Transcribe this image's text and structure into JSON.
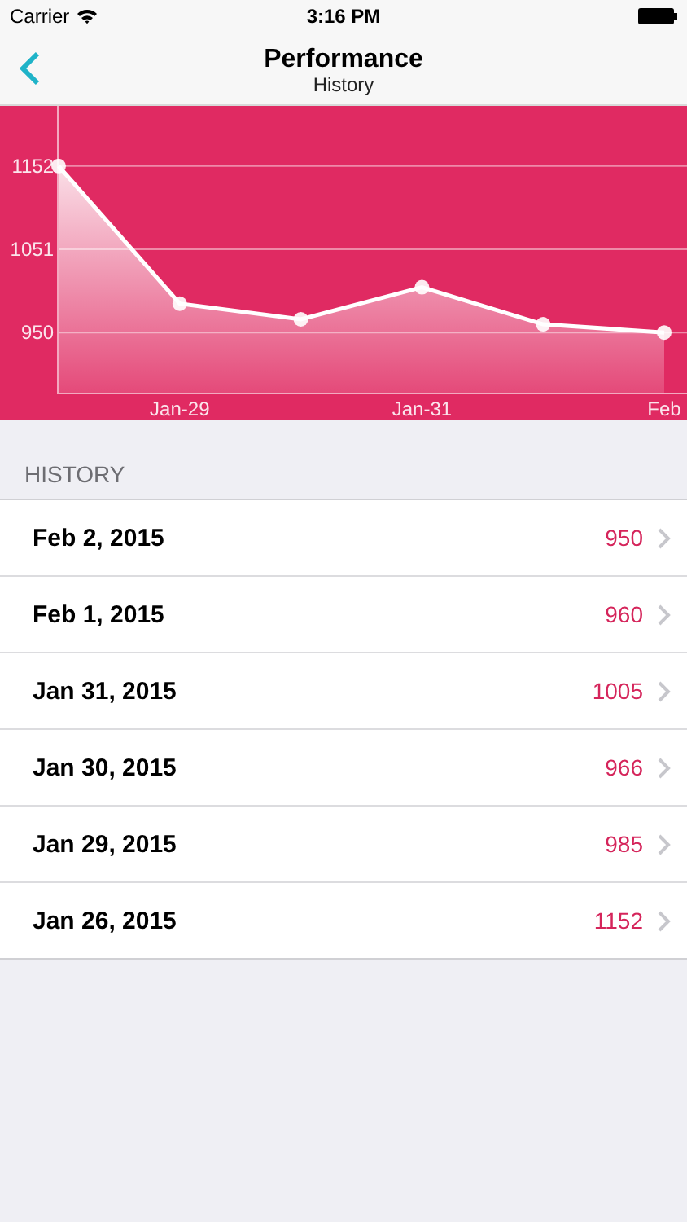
{
  "status_bar": {
    "carrier": "Carrier",
    "time": "3:16 PM"
  },
  "nav": {
    "title": "Performance",
    "subtitle": "History"
  },
  "chart": {
    "chart_data": {
      "type": "area",
      "categories": [
        null,
        "Jan-29",
        null,
        "Jan-31",
        null,
        "Feb"
      ],
      "series": [
        {
          "color": "#ffffff",
          "values": [
            1152,
            985,
            966,
            1005,
            960,
            950
          ]
        }
      ],
      "ylim": [
        877,
        1225
      ],
      "yticks": [
        950,
        1051,
        1152
      ],
      "grid": true
    }
  },
  "section_header": "HISTORY",
  "rows": [
    {
      "date": "Feb 2, 2015",
      "value": "950"
    },
    {
      "date": "Feb 1, 2015",
      "value": "960"
    },
    {
      "date": "Jan 31, 2015",
      "value": "1005"
    },
    {
      "date": "Jan 30, 2015",
      "value": "966"
    },
    {
      "date": "Jan 29, 2015",
      "value": "985"
    },
    {
      "date": "Jan 26, 2015",
      "value": "1152"
    }
  ]
}
